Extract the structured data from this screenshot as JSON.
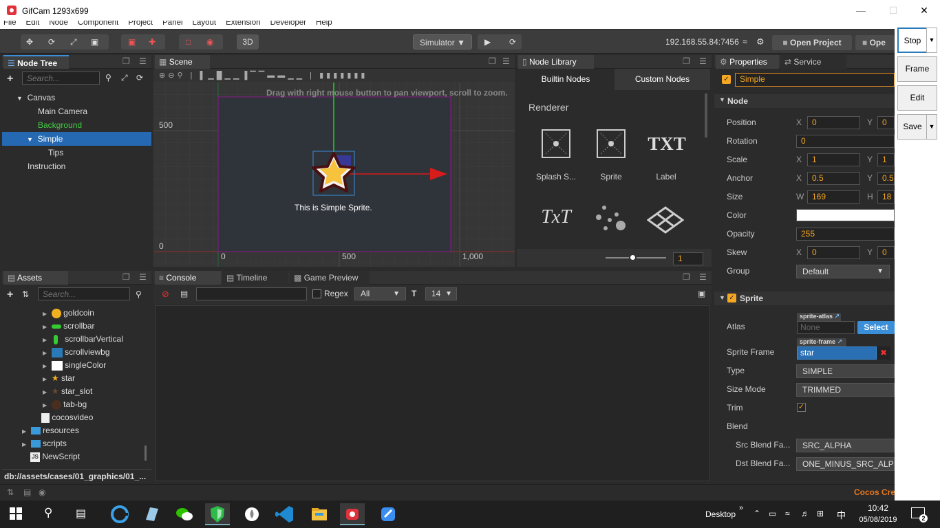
{
  "window": {
    "title": "GifCam 1293x699"
  },
  "menu": [
    "File",
    "Edit",
    "Node",
    "Component",
    "Project",
    "Panel",
    "Layout",
    "Extension",
    "Developer",
    "Help"
  ],
  "toolbar": {
    "btn3d": "3D",
    "simulator": "Simulator ▼",
    "ip": "192.168.55.84:7456",
    "open_project": "Open Project",
    "open_other": "Ope"
  },
  "nodetree": {
    "tab": "Node Tree",
    "search_placeholder": "Search...",
    "items": [
      {
        "label": "Canvas",
        "depth": 1
      },
      {
        "label": "Main Camera",
        "depth": 2
      },
      {
        "label": "Background",
        "depth": 2
      },
      {
        "label": "Simple",
        "depth": 2
      },
      {
        "label": "Tips",
        "depth": 3
      },
      {
        "label": "Instruction",
        "depth": 1
      }
    ]
  },
  "scene": {
    "tab": "Scene",
    "hint": "Drag with right mouse button to pan viewport, scroll to zoom.",
    "y500": "500",
    "y0": "0",
    "x0": "0",
    "x500": "500",
    "x1000": "1,000",
    "sprite_text": "This is Simple Sprite."
  },
  "library": {
    "tab": "Node Library",
    "tab_builtin": "Builtin Nodes",
    "tab_custom": "Custom Nodes",
    "section": "Renderer",
    "items": [
      "Splash S...",
      "Sprite",
      "Label"
    ],
    "txt_icon": "TXT",
    "txt2_icon": "TxT",
    "slider_value": "1"
  },
  "properties": {
    "tab": "Properties",
    "tab_service": "Service",
    "node_name": "Simple",
    "node_section": "Node",
    "rows": {
      "position": {
        "label": "Position",
        "x": "0",
        "y": "0"
      },
      "rotation": {
        "label": "Rotation",
        "v": "0"
      },
      "scale": {
        "label": "Scale",
        "x": "1",
        "y": "1"
      },
      "anchor": {
        "label": "Anchor",
        "x": "0.5",
        "y": "0.5"
      },
      "size": {
        "label": "Size",
        "w": "169",
        "h": "18"
      },
      "color": {
        "label": "Color"
      },
      "opacity": {
        "label": "Opacity",
        "v": "255"
      },
      "skew": {
        "label": "Skew",
        "x": "0",
        "y": "0"
      },
      "group": {
        "label": "Group",
        "v": "Default"
      }
    },
    "axis": {
      "x": "X",
      "y": "Y",
      "w": "W",
      "h": "H"
    },
    "sprite_section": "Sprite",
    "atlas": {
      "label": "Atlas",
      "tag": "sprite-atlas",
      "value": "None",
      "select": "Select"
    },
    "frame": {
      "label": "Sprite Frame",
      "tag": "sprite-frame",
      "value": "star"
    },
    "type": {
      "label": "Type",
      "v": "SIMPLE"
    },
    "size_mode": {
      "label": "Size Mode",
      "v": "TRIMMED"
    },
    "trim": {
      "label": "Trim"
    },
    "blend": {
      "label": "Blend"
    },
    "src_blend": {
      "label": "Src Blend Fa...",
      "v": "SRC_ALPHA"
    },
    "dst_blend": {
      "label": "Dst Blend Fa...",
      "v": "ONE_MINUS_SRC_ALPHA"
    }
  },
  "assets": {
    "tab": "Assets",
    "search_placeholder": "Search...",
    "items": [
      "goldcoin",
      "scrollbar",
      "scrollbarVertical",
      "scrollviewbg",
      "singleColor",
      "star",
      "star_slot",
      "tab-bg",
      "cocosvideo",
      "resources",
      "scripts",
      "NewScript"
    ],
    "path": "db://assets/cases/01_graphics/01_..."
  },
  "console": {
    "tab_console": "Console",
    "tab_timeline": "Timeline",
    "tab_preview": "Game Preview",
    "regex": "Regex",
    "filter": "All",
    "fontsize": "14"
  },
  "status": {
    "brand": "Cocos Cre"
  },
  "gifcam": {
    "stop": "Stop",
    "frame": "Frame",
    "edit": "Edit",
    "save": "Save"
  },
  "taskbar": {
    "desktop": "Desktop",
    "time": "10:42",
    "date": "05/08/2019",
    "lang": "中",
    "badge": "2"
  }
}
